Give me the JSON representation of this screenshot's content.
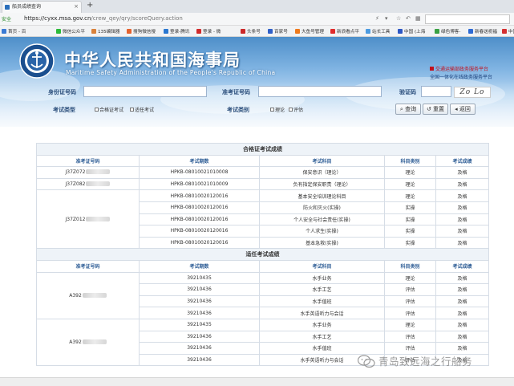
{
  "browser": {
    "tab_title": "船员成绩查询",
    "tab_close": "×",
    "new_tab": "+",
    "secure_label": "安全",
    "url_host": "https://cyxx.msa.gov.cn",
    "url_path": "/crew_qey/qry/scoreQuery.action",
    "bookmarks": [
      "首页 - 百",
      "微信公众平",
      "135编辑器",
      "搜狗微信搜",
      "登录-腾讯",
      "登录 - 微",
      "头条号",
      "百家号",
      "大鱼号管理",
      "新浪看点平",
      "站长工具",
      "中国 (上海",
      "绿色博客-",
      "新春送祝福",
      "中国"
    ]
  },
  "header": {
    "title": "中华人民共和国海事局",
    "subtitle": "Maritime Safety Administration of the People's Republic of China",
    "emblem_text": "CHINA MSA",
    "portal_line1": "交通运输部政务服务平台",
    "portal_line2": "全国一体化在线政务服务平台"
  },
  "form": {
    "id_label": "身份证号码",
    "ticket_label": "准考证号码",
    "captcha_label": "验证码",
    "captcha_value": "Zo Lo",
    "exam_type_label": "考试类型",
    "exam_type_options": [
      "合格证考试",
      "适任考试"
    ],
    "exam_category_label": "考试类别",
    "exam_category_options": [
      "理论",
      "评估"
    ],
    "query_button": "查询",
    "reset_button": "重置",
    "back_button": "返回"
  },
  "colors": {
    "header_blue": "#4e8fc9",
    "column_header": "#2f5e96",
    "accent_red": "#c1121f"
  },
  "table1": {
    "title": "合格证考试成绩",
    "columns": [
      "准考证号码",
      "考试期数",
      "考试科目",
      "科目类别",
      "考试成绩"
    ],
    "rows": [
      {
        "ticket": "J37Z072",
        "period": "HPKB-08010021010008",
        "subject": "保安意识（理论）",
        "category": "理论",
        "result": "及格"
      },
      {
        "ticket": "J37Z082",
        "period": "HPKB-08010021010009",
        "subject": "负有指定保安职责（理论）",
        "category": "理论",
        "result": "及格"
      },
      {
        "ticket": "J37Z012",
        "period": "HPKB-08010020120016",
        "subject": "基本安全培训理论科目",
        "category": "理论",
        "result": "及格"
      },
      {
        "ticket": "",
        "period": "HPKB-08010020120016",
        "subject": "防火和灭火(实操)",
        "category": "实操",
        "result": "及格"
      },
      {
        "ticket": "",
        "period": "HPKB-08010020120016",
        "subject": "个人安全与社会责任(实操)",
        "category": "实操",
        "result": "及格"
      },
      {
        "ticket": "",
        "period": "HPKB-08010020120016",
        "subject": "个人求生(实操)",
        "category": "实操",
        "result": "及格"
      },
      {
        "ticket": "",
        "period": "HPKB-08010020120016",
        "subject": "基本急救(实操)",
        "category": "实操",
        "result": "及格"
      }
    ]
  },
  "table2": {
    "title": "适任考试成绩",
    "columns": [
      "准考证号码",
      "考试期数",
      "考试科目",
      "科目类别",
      "考试成绩"
    ],
    "groups": [
      {
        "ticket": "A392",
        "rows": [
          {
            "period": "39210435",
            "subject": "水手业务",
            "category": "理论",
            "result": "及格"
          },
          {
            "period": "39210436",
            "subject": "水手工艺",
            "category": "评估",
            "result": "及格"
          },
          {
            "period": "39210436",
            "subject": "水手值班",
            "category": "评估",
            "result": "及格"
          },
          {
            "period": "39210436",
            "subject": "水手英语听力与会话",
            "category": "评估",
            "result": "及格"
          }
        ]
      },
      {
        "ticket": "A392",
        "rows": [
          {
            "period": "39210435",
            "subject": "水手业务",
            "category": "理论",
            "result": "及格"
          },
          {
            "period": "39210436",
            "subject": "水手工艺",
            "category": "评估",
            "result": "及格"
          },
          {
            "period": "39210436",
            "subject": "水手值班",
            "category": "评估",
            "result": "及格"
          },
          {
            "period": "39210436",
            "subject": "水手英语听力与会话",
            "category": "评估",
            "result": "及格"
          }
        ]
      }
    ]
  },
  "watermark": "青岛致远海之行船务"
}
